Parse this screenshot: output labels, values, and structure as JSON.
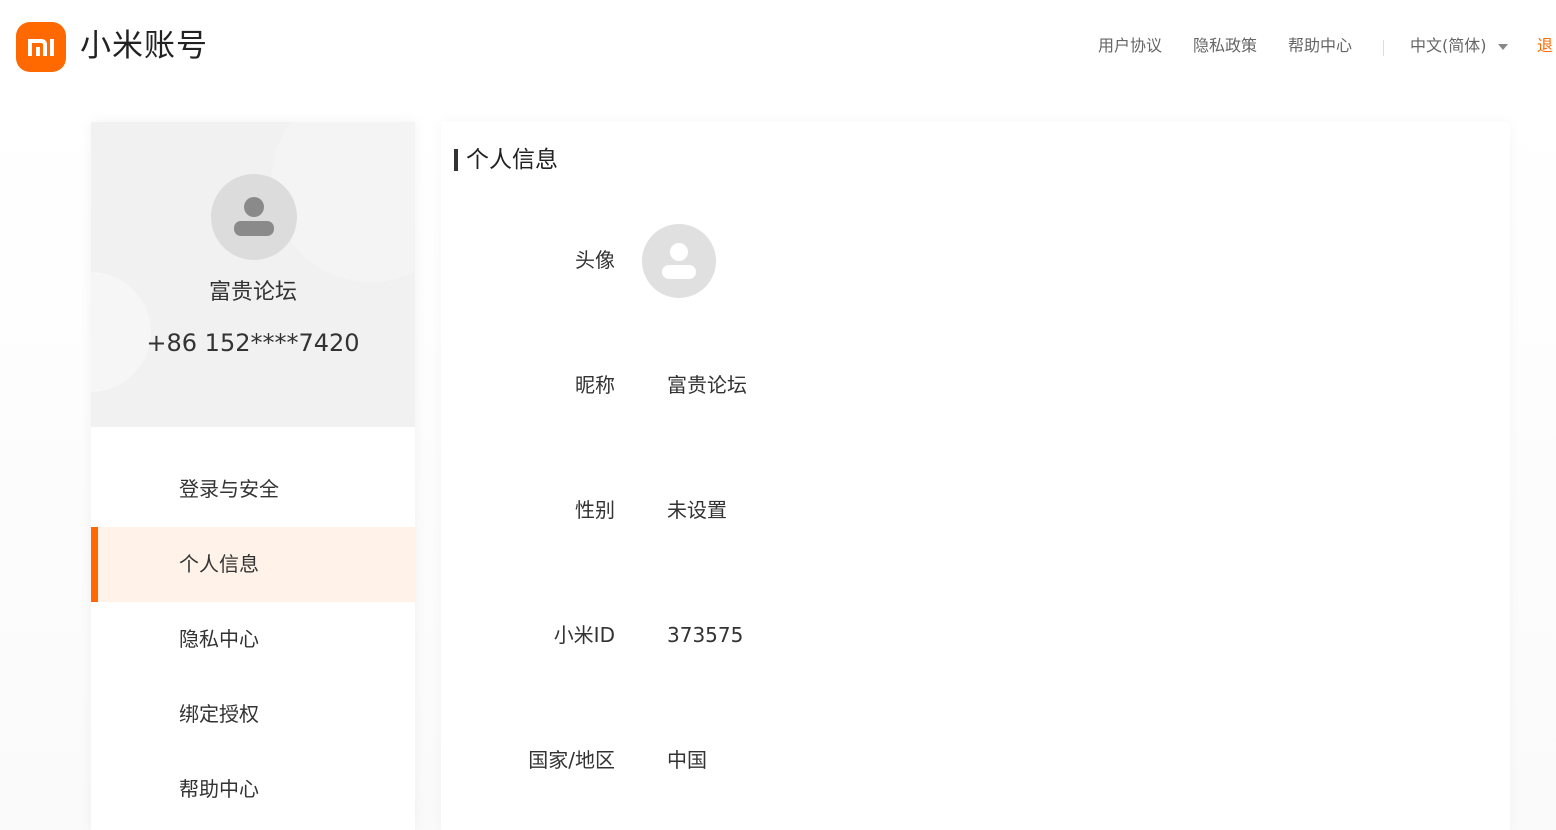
{
  "brand": {
    "title": "小米账号",
    "logo_text": "mi"
  },
  "top_nav": {
    "user_agreement": "用户协议",
    "privacy_policy": "隐私政策",
    "help_center": "帮助中心",
    "language": "中文(简体)",
    "logout": "退"
  },
  "profile": {
    "name": "富贵论坛",
    "phone": "+86 152****7420"
  },
  "sidebar": {
    "items": [
      {
        "label": "登录与安全",
        "active": false
      },
      {
        "label": "个人信息",
        "active": true
      },
      {
        "label": "隐私中心",
        "active": false
      },
      {
        "label": "绑定授权",
        "active": false
      },
      {
        "label": "帮助中心",
        "active": false
      }
    ]
  },
  "main": {
    "title": "个人信息",
    "fields": {
      "avatar": {
        "label": "头像"
      },
      "nickname": {
        "label": "昵称",
        "value": "富贵论坛"
      },
      "gender": {
        "label": "性别",
        "value": "未设置"
      },
      "mi_id": {
        "label": "小米ID",
        "value": "373575"
      },
      "region": {
        "label": "国家/地区",
        "value": "中国"
      }
    }
  },
  "colors": {
    "accent": "#ff6900",
    "active_bg": "#fff3e9",
    "card_bg": "#f1f1f1"
  },
  "icons": {
    "avatar": "user-avatar-icon",
    "logo": "mi-logo-icon",
    "caret": "chevron-down-icon"
  }
}
